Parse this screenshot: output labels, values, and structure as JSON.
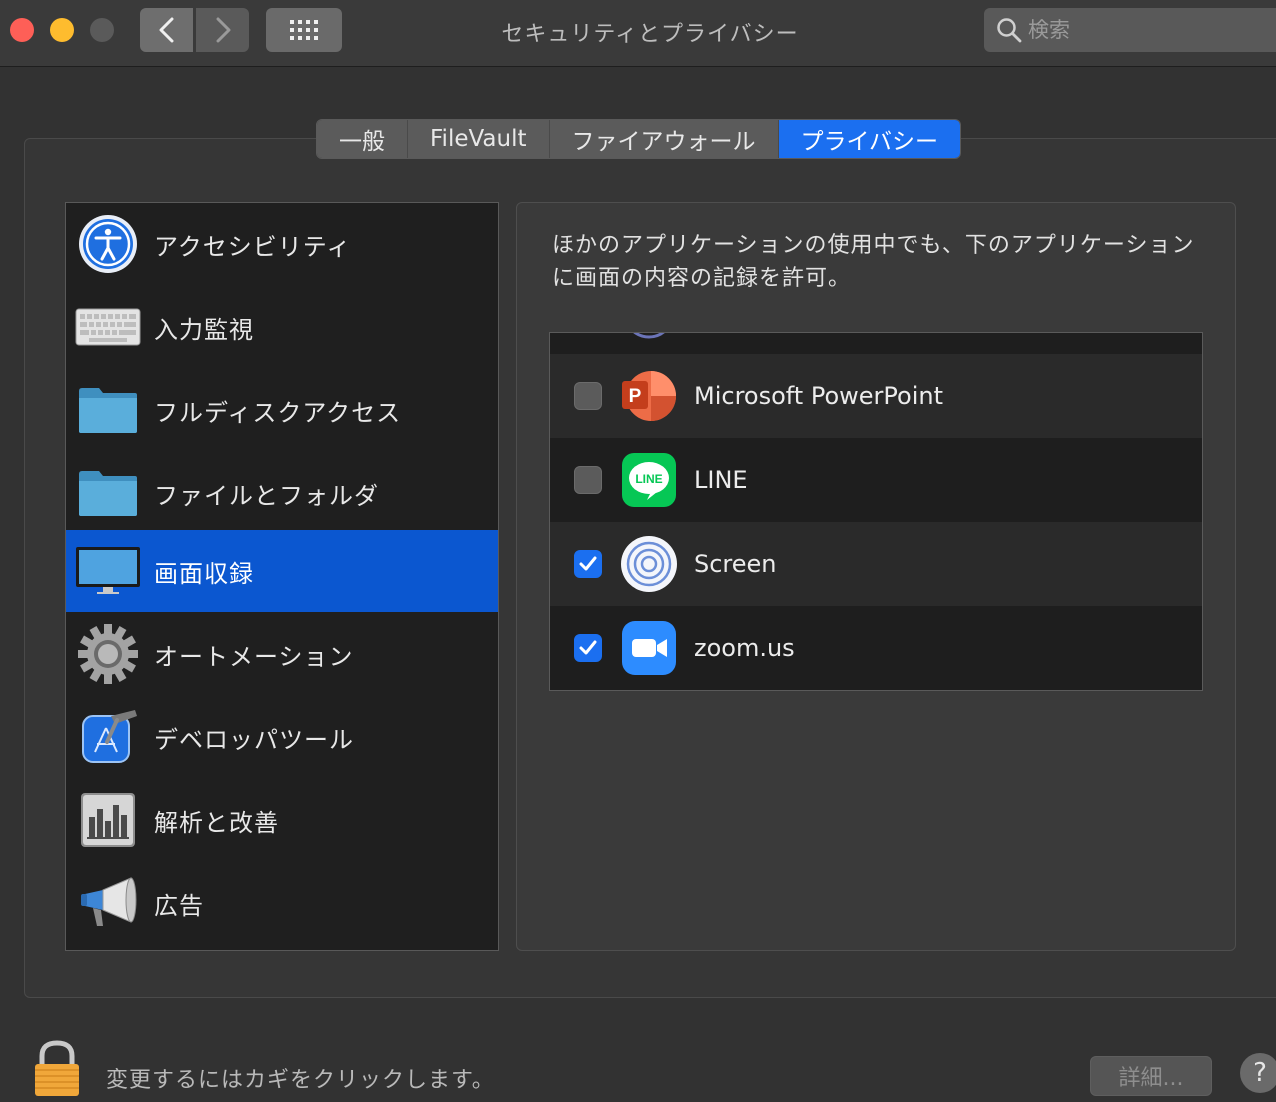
{
  "window": {
    "title": "セキュリティとプライバシー",
    "search_placeholder": "検索"
  },
  "tabs": [
    {
      "label": "一般",
      "active": false
    },
    {
      "label": "FileVault",
      "active": false
    },
    {
      "label": "ファイアウォール",
      "active": false
    },
    {
      "label": "プライバシー",
      "active": true
    }
  ],
  "sidebar": {
    "items": [
      {
        "label": "アクセシビリティ",
        "icon": "accessibility-icon",
        "selected": false
      },
      {
        "label": "入力監視",
        "icon": "keyboard-icon",
        "selected": false
      },
      {
        "label": "フルディスクアクセス",
        "icon": "folder-icon",
        "selected": false
      },
      {
        "label": "ファイルとフォルダ",
        "icon": "folder-icon",
        "selected": false
      },
      {
        "label": "画面収録",
        "icon": "display-icon",
        "selected": true
      },
      {
        "label": "オートメーション",
        "icon": "gear-icon",
        "selected": false
      },
      {
        "label": "デベロッパツール",
        "icon": "xcode-icon",
        "selected": false
      },
      {
        "label": "解析と改善",
        "icon": "chart-icon",
        "selected": false
      },
      {
        "label": "広告",
        "icon": "megaphone-icon",
        "selected": false
      }
    ]
  },
  "panel": {
    "description": "ほかのアプリケーションの使用中でも、下のアプリケーションに画面の内容の記録を許可。",
    "apps": [
      {
        "name": "Microsoft PowerPoint",
        "checked": false,
        "icon": "powerpoint-icon"
      },
      {
        "name": "LINE",
        "checked": false,
        "icon": "line-icon"
      },
      {
        "name": "Screen",
        "checked": true,
        "icon": "screen-app-icon"
      },
      {
        "name": "zoom.us",
        "checked": true,
        "icon": "zoom-icon"
      }
    ]
  },
  "footer": {
    "lock_text": "変更するにはカギをクリックします。",
    "detail_button": "詳細...",
    "help_button": "?"
  },
  "colors": {
    "accent": "#1b6ff0",
    "selected_row": "#0b57d0"
  }
}
